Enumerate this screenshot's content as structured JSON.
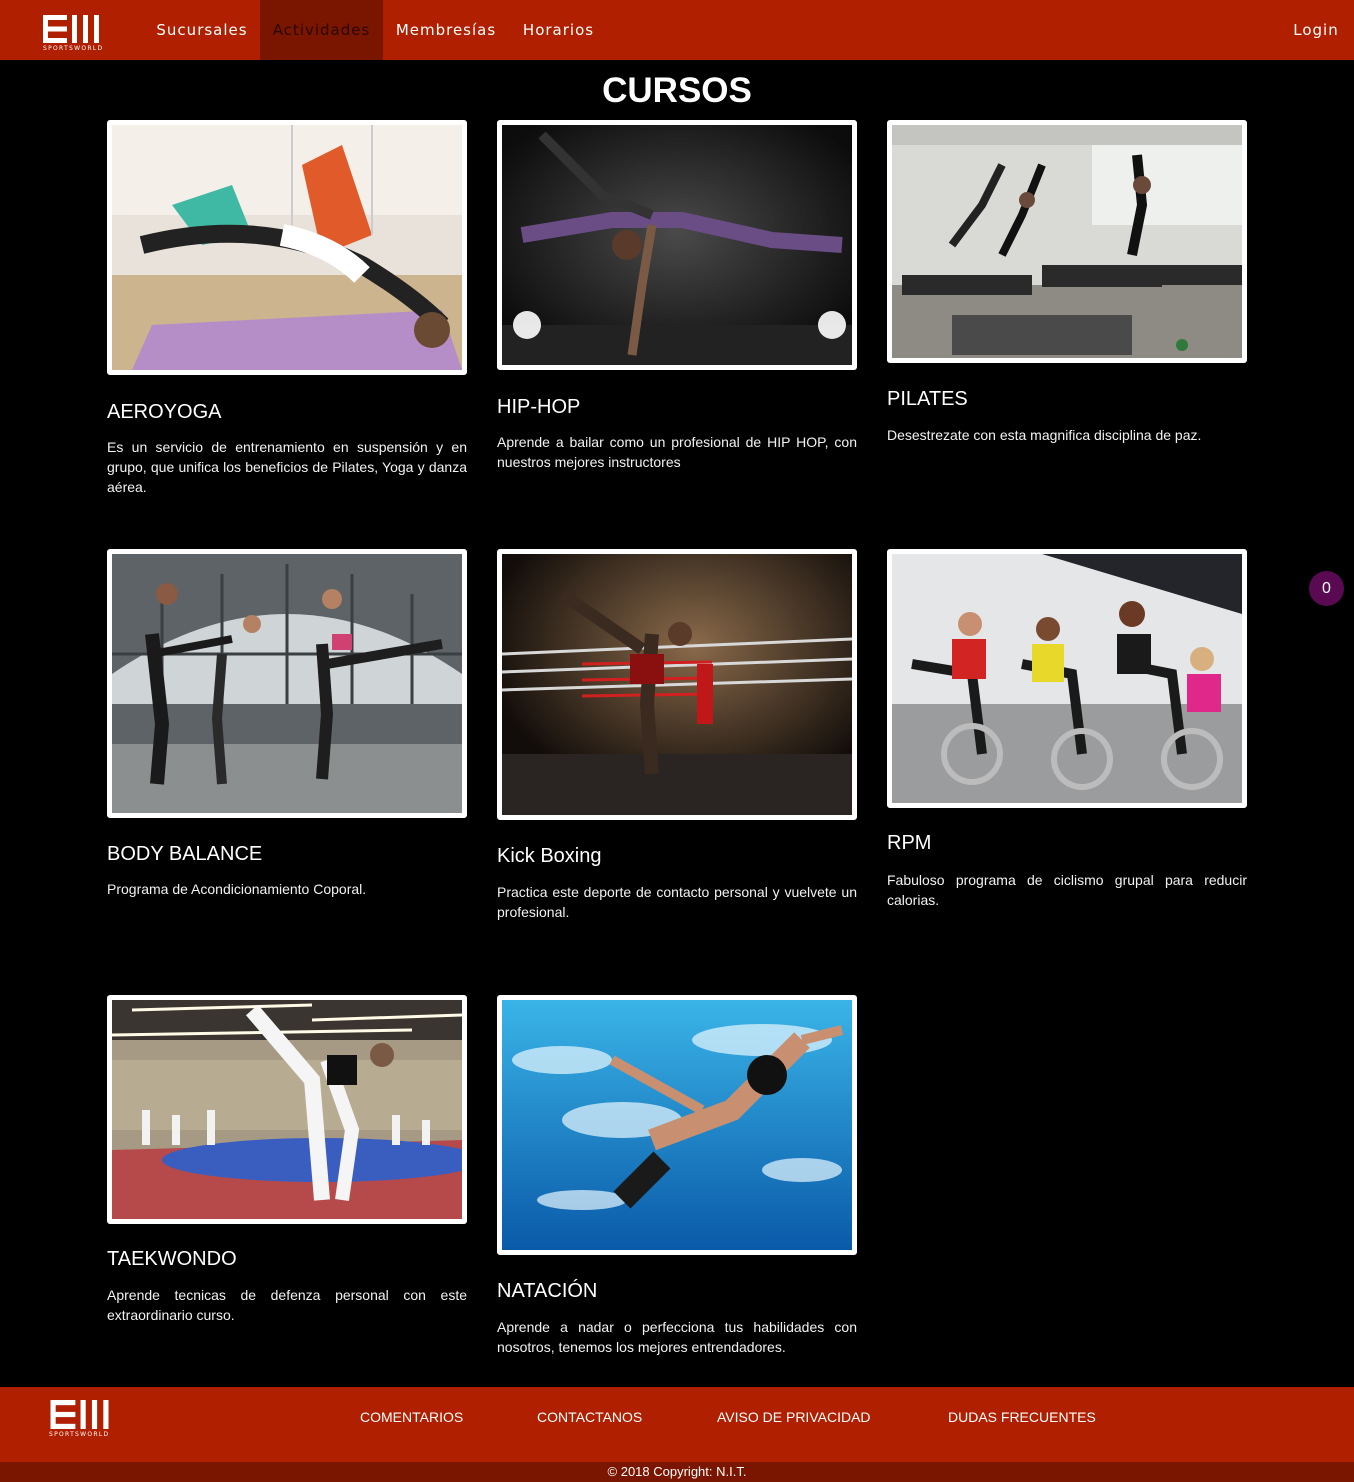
{
  "brand": {
    "name": "SPORTSWORLD"
  },
  "nav": {
    "items": [
      {
        "label": "Sucursales"
      },
      {
        "label": "Actividades",
        "active": true
      },
      {
        "label": "Membresías"
      },
      {
        "label": "Horarios"
      }
    ],
    "login_label": "Login"
  },
  "page": {
    "title": "CURSOS"
  },
  "courses": [
    {
      "title": "AEROYOGA",
      "description": "Es un servicio de entrenamiento en suspensión y en grupo, que unifica los beneficios de Pilates, Yoga y danza aérea.",
      "image": "aerial-yoga-photo"
    },
    {
      "title": "HIP-HOP",
      "description": "Aprende a bailar como un profesional de HIP HOP, con nuestros mejores instructores",
      "image": "hip-hop-dancer-photo"
    },
    {
      "title": "PILATES",
      "description": "Desestrezate con esta magnifica disciplina de paz.",
      "image": "pilates-class-photo"
    },
    {
      "title": "BODY BALANCE",
      "description": "Programa de Acondicionamiento Coporal.",
      "image": "body-balance-class-photo"
    },
    {
      "title": "Kick Boxing",
      "description": "Practica este deporte de contacto personal y vuelvete un profesional.",
      "image": "kick-boxing-photo"
    },
    {
      "title": "RPM",
      "description": "Fabuloso programa de ciclismo grupal para reducir calorias.",
      "image": "spinning-class-photo"
    },
    {
      "title": "TAEKWONDO",
      "description": "Aprende tecnicas de defenza personal con este extraordinario curso.",
      "image": "taekwondo-photo"
    },
    {
      "title": "NATACIÓN",
      "description": "Aprende a nadar o perfecciona tus habilidades con nosotros, tenemos los mejores entrendadores.",
      "image": "swimmer-photo"
    }
  ],
  "badge": {
    "count": "0"
  },
  "footer": {
    "links": [
      {
        "label": "COMENTARIOS"
      },
      {
        "label": "CONTACTANOS"
      },
      {
        "label": "AVISO DE PRIVACIDAD"
      },
      {
        "label": "DUDAS FRECUENTES"
      }
    ],
    "copyright": "© 2018 Copyright: N.I.T."
  },
  "colors": {
    "primary": "#b01f00",
    "primary_dark": "#7a1500",
    "badge": "#5a0a52",
    "background": "#000000"
  }
}
